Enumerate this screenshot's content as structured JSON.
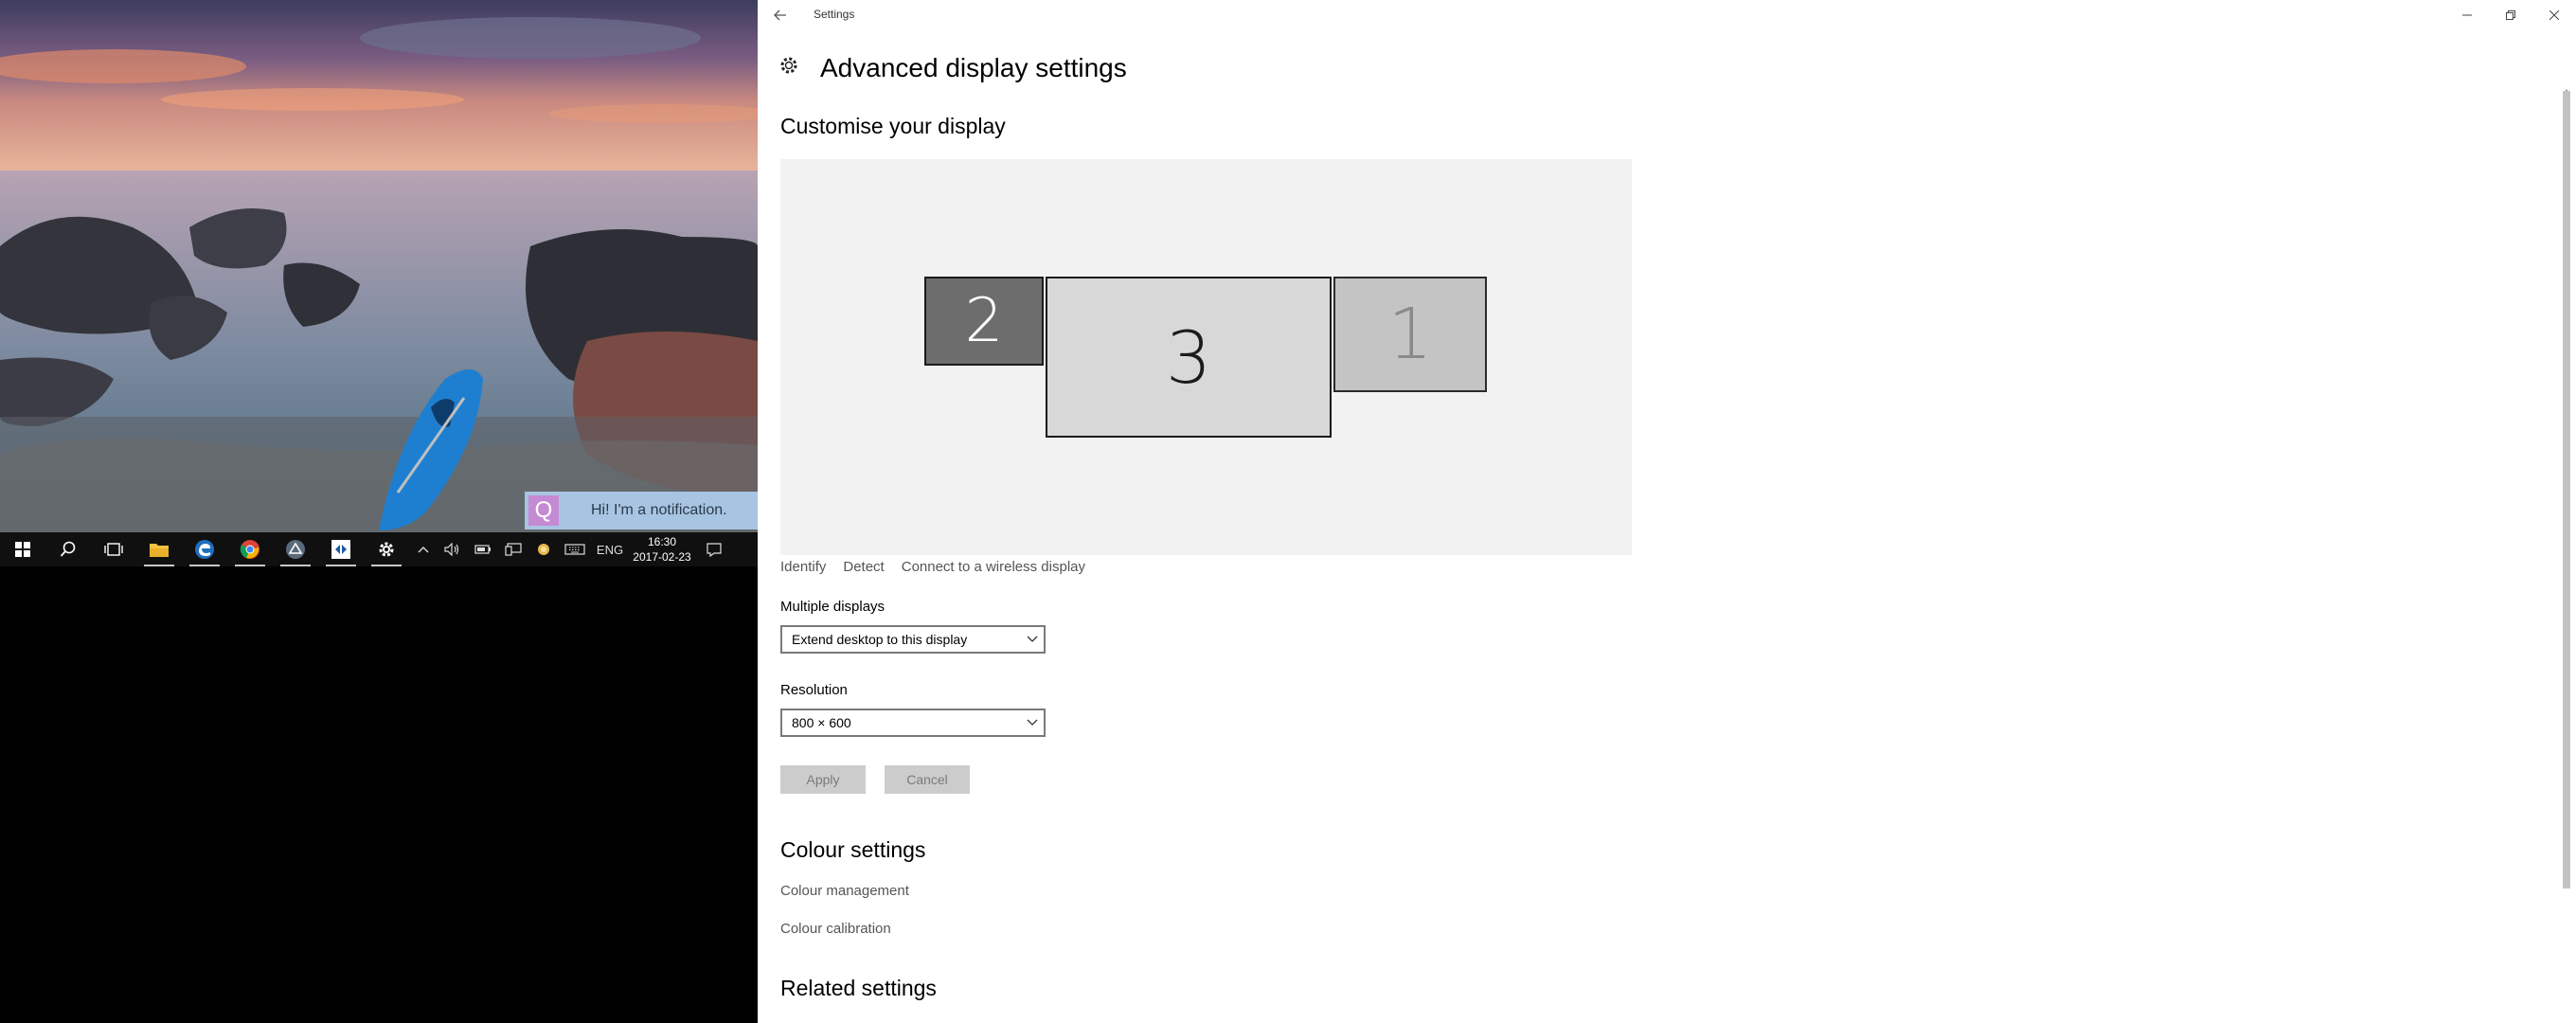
{
  "notification": {
    "icon_letter": "Q",
    "text": "Hi! I'm a notification."
  },
  "taskbar": {
    "items": [
      {
        "name": "start-icon"
      },
      {
        "name": "search-icon"
      },
      {
        "name": "task-view-icon"
      },
      {
        "name": "file-explorer-icon"
      },
      {
        "name": "edge-icon"
      },
      {
        "name": "chrome-icon"
      },
      {
        "name": "app-icon"
      },
      {
        "name": "remote-icon"
      },
      {
        "name": "gear-icon"
      }
    ],
    "tray": {
      "language": "ENG",
      "time": "16:30",
      "date": "2017-02-23"
    }
  },
  "window": {
    "title": "Settings",
    "page_title": "Advanced display settings"
  },
  "customise": {
    "heading": "Customise your display",
    "monitors": [
      {
        "id": "2"
      },
      {
        "id": "3"
      },
      {
        "id": "1"
      }
    ],
    "links": {
      "identify": "Identify",
      "detect": "Detect",
      "wireless": "Connect to a wireless display"
    }
  },
  "multiple_displays": {
    "label": "Multiple displays",
    "value": "Extend desktop to this display"
  },
  "resolution": {
    "label": "Resolution",
    "value": "800 × 600"
  },
  "buttons": {
    "apply": "Apply",
    "cancel": "Cancel"
  },
  "colour": {
    "heading": "Colour settings",
    "management": "Colour management",
    "calibration": "Colour calibration"
  },
  "related": {
    "heading": "Related settings"
  },
  "colors": {
    "taskbar_bg": "#101010",
    "notification_bg": "#a7c4e2",
    "notification_icon_bg": "#c58ad4",
    "display_area_bg": "#f2f2f2",
    "button_disabled_bg": "#cccccc"
  }
}
